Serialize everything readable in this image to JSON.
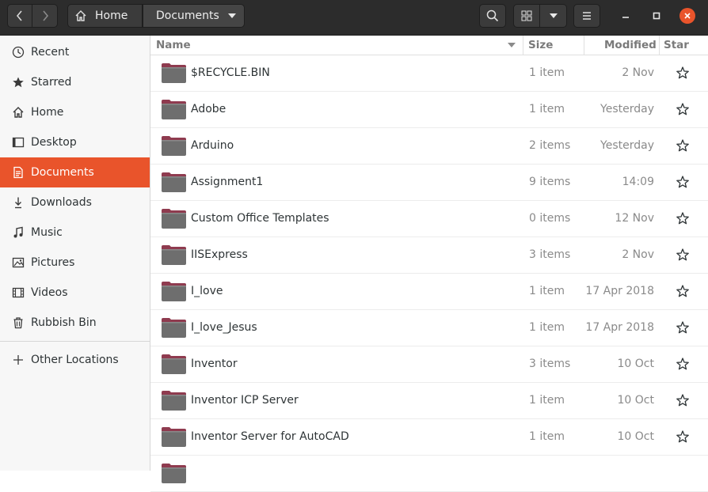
{
  "header": {
    "breadcrumb_home": "Home",
    "breadcrumb_current": "Documents",
    "icons": [
      "back-icon",
      "forward-icon",
      "home-icon",
      "search-icon",
      "grid-view-icon",
      "menu-icon",
      "minimize-icon",
      "maximize-icon",
      "close-icon"
    ]
  },
  "sidebar": {
    "items": [
      {
        "label": "Recent",
        "icon": "clock-icon"
      },
      {
        "label": "Starred",
        "icon": "star-icon"
      },
      {
        "label": "Home",
        "icon": "home-icon"
      },
      {
        "label": "Desktop",
        "icon": "desktop-icon"
      },
      {
        "label": "Documents",
        "icon": "document-icon",
        "active": true
      },
      {
        "label": "Downloads",
        "icon": "download-icon"
      },
      {
        "label": "Music",
        "icon": "music-icon"
      },
      {
        "label": "Pictures",
        "icon": "picture-icon"
      },
      {
        "label": "Videos",
        "icon": "video-icon"
      },
      {
        "label": "Rubbish Bin",
        "icon": "trash-icon"
      }
    ],
    "other_locations": "Other Locations"
  },
  "columns": {
    "name": "Name",
    "size": "Size",
    "modified": "Modified",
    "star": "Star"
  },
  "files": [
    {
      "name": "$RECYCLE.BIN",
      "size": "1 item",
      "modified": "2 Nov"
    },
    {
      "name": "Adobe",
      "size": "1 item",
      "modified": "Yesterday"
    },
    {
      "name": "Arduino",
      "size": "2 items",
      "modified": "Yesterday"
    },
    {
      "name": "Assignment1",
      "size": "9 items",
      "modified": "14:09"
    },
    {
      "name": "Custom Office Templates",
      "size": "0 items",
      "modified": "12 Nov"
    },
    {
      "name": "IISExpress",
      "size": "3 items",
      "modified": "2 Nov"
    },
    {
      "name": "I_love",
      "size": "1 item",
      "modified": "17 Apr 2018"
    },
    {
      "name": "I_love_Jesus",
      "size": "1 item",
      "modified": "17 Apr 2018"
    },
    {
      "name": "Inventor",
      "size": "3 items",
      "modified": "10 Oct"
    },
    {
      "name": "Inventor ICP Server",
      "size": "1 item",
      "modified": "10 Oct"
    },
    {
      "name": "Inventor Server for AutoCAD",
      "size": "1 item",
      "modified": "10 Oct"
    }
  ],
  "colors": {
    "accent": "#e9542b",
    "headerbar": "#2c2c2c",
    "folder_body": "#6e6e6e",
    "folder_tab": "#8f3b4f"
  }
}
